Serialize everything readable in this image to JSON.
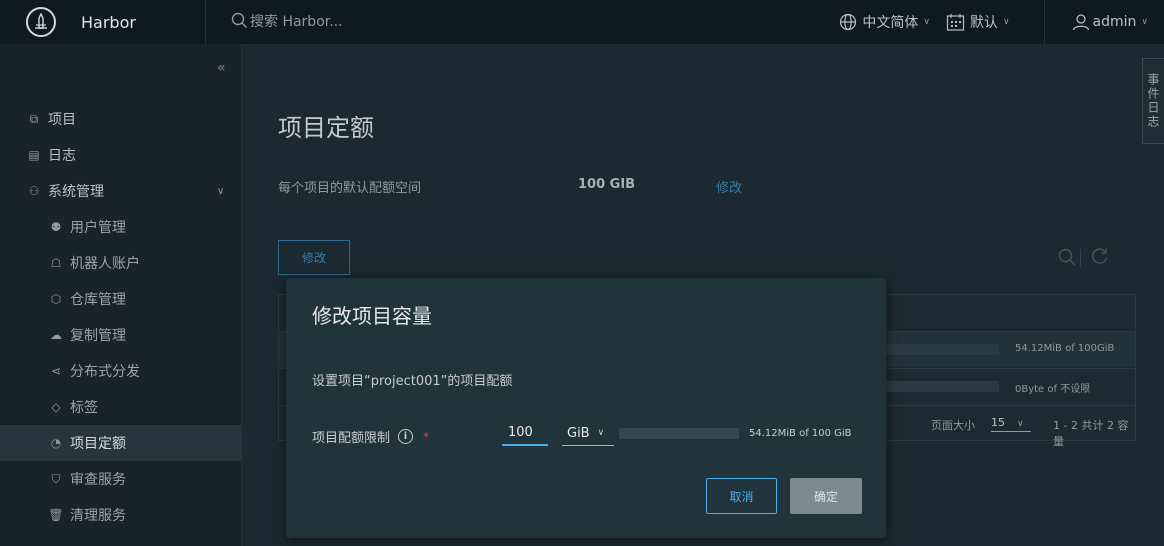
{
  "header": {
    "brand_name": "Harbor",
    "search_placeholder": "搜索 Harbor...",
    "language": "中文简体",
    "theme": "默认",
    "user": "admin"
  },
  "sidebar": {
    "items": [
      {
        "label": "项目",
        "icon": "project-icon"
      },
      {
        "label": "日志",
        "icon": "log-icon"
      },
      {
        "label": "系统管理",
        "icon": "admin-icon"
      },
      {
        "label": "用户管理",
        "icon": "users-icon"
      },
      {
        "label": "机器人账户",
        "icon": "robot-icon"
      },
      {
        "label": "仓库管理",
        "icon": "registry-icon"
      },
      {
        "label": "复制管理",
        "icon": "replication-icon"
      },
      {
        "label": "分布式分发",
        "icon": "distribution-icon"
      },
      {
        "label": "标签",
        "icon": "tag-icon"
      },
      {
        "label": "项目定额",
        "icon": "quota-icon",
        "active": true
      },
      {
        "label": "审查服务",
        "icon": "shield-icon"
      },
      {
        "label": "清理服务",
        "icon": "trash-icon"
      }
    ]
  },
  "main": {
    "title": "项目定额",
    "default_quota_label": "每个项目的默认配额空间",
    "default_quota_value": "100 GIB",
    "default_quota_edit": "修改",
    "edit_button": "修改",
    "rows": [
      {
        "usage": "54.12MiB of 100GiB"
      },
      {
        "usage": "0Byte of 不设限"
      }
    ],
    "pager": {
      "label": "页面大小",
      "size": "15",
      "count": "1 - 2 共计 2 容量"
    }
  },
  "event_log_tab": "事件日志",
  "modal": {
    "title": "修改项目容量",
    "description": "设置项目“project001”的项目配额",
    "quota_label": "项目配额限制",
    "quota_value": "100",
    "unit": "GiB",
    "usage_text": "54.12MiB of 100 GiB",
    "usage_fraction": 0.0005,
    "cancel": "取消",
    "ok": "确定"
  }
}
